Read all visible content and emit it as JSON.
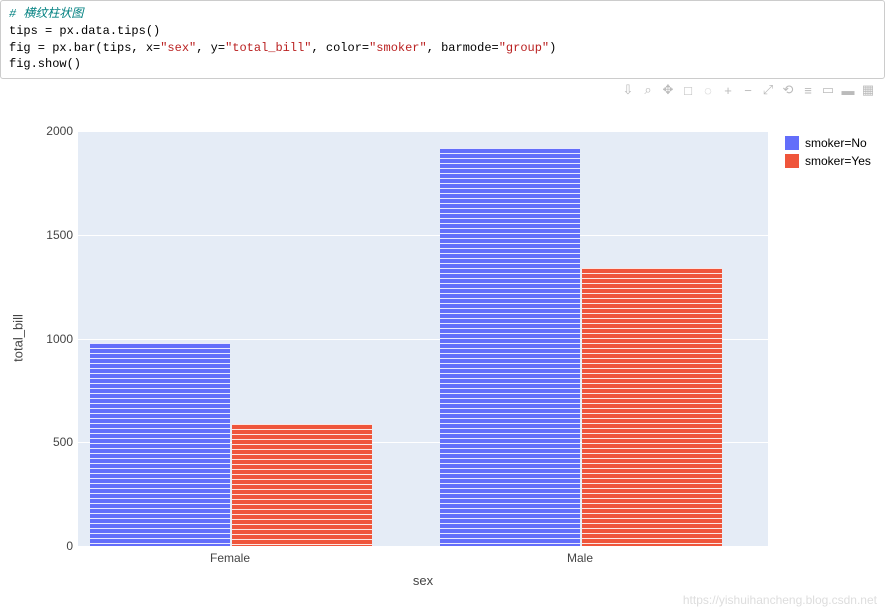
{
  "code": {
    "comment": "# 横纹柱状图",
    "line2_pre": "tips = px.data.tips()",
    "line3_a": "fig = px.bar(tips, x=",
    "line3_s1": "\"sex\"",
    "line3_b": ", y=",
    "line3_s2": "\"total_bill\"",
    "line3_c": ", color=",
    "line3_s3": "\"smoker\"",
    "line3_d": ", barmode=",
    "line3_s4": "\"group\"",
    "line3_e": ")",
    "line4": "fig.show()"
  },
  "toolbar": {
    "download": "⇩",
    "zoom": "⌕",
    "pan": "✥",
    "boxselect": "□",
    "lasso": "◌",
    "zoomin": "+",
    "zoomout": "−",
    "autoscale": "⤢",
    "reset": "⟲",
    "spike": "≡",
    "hover1": "▭",
    "hover2": "▬",
    "logo": "▦"
  },
  "legend": {
    "no": "smoker=No",
    "yes": "smoker=Yes"
  },
  "axis": {
    "xlabel": "sex",
    "ylabel": "total_bill",
    "yticks": {
      "0": "0",
      "1": "500",
      "2": "1000",
      "3": "1500",
      "4": "2000"
    },
    "xticks": {
      "0": "Female",
      "1": "Male"
    }
  },
  "watermark": "https://yishuihancheng.blog.csdn.net",
  "chart_data": {
    "type": "bar",
    "barmode": "group",
    "title": "",
    "xlabel": "sex",
    "ylabel": "total_bill",
    "ylim": [
      0,
      2000
    ],
    "categories": [
      "Female",
      "Male"
    ],
    "series": [
      {
        "name": "smoker=No",
        "color": "#636efa",
        "values": [
          980,
          1920
        ]
      },
      {
        "name": "smoker=Yes",
        "color": "#ef553b",
        "values": [
          590,
          1340
        ]
      }
    ],
    "notes": "Bars show horizontal white stripe texture; stacked appearance from many small summed segments."
  }
}
